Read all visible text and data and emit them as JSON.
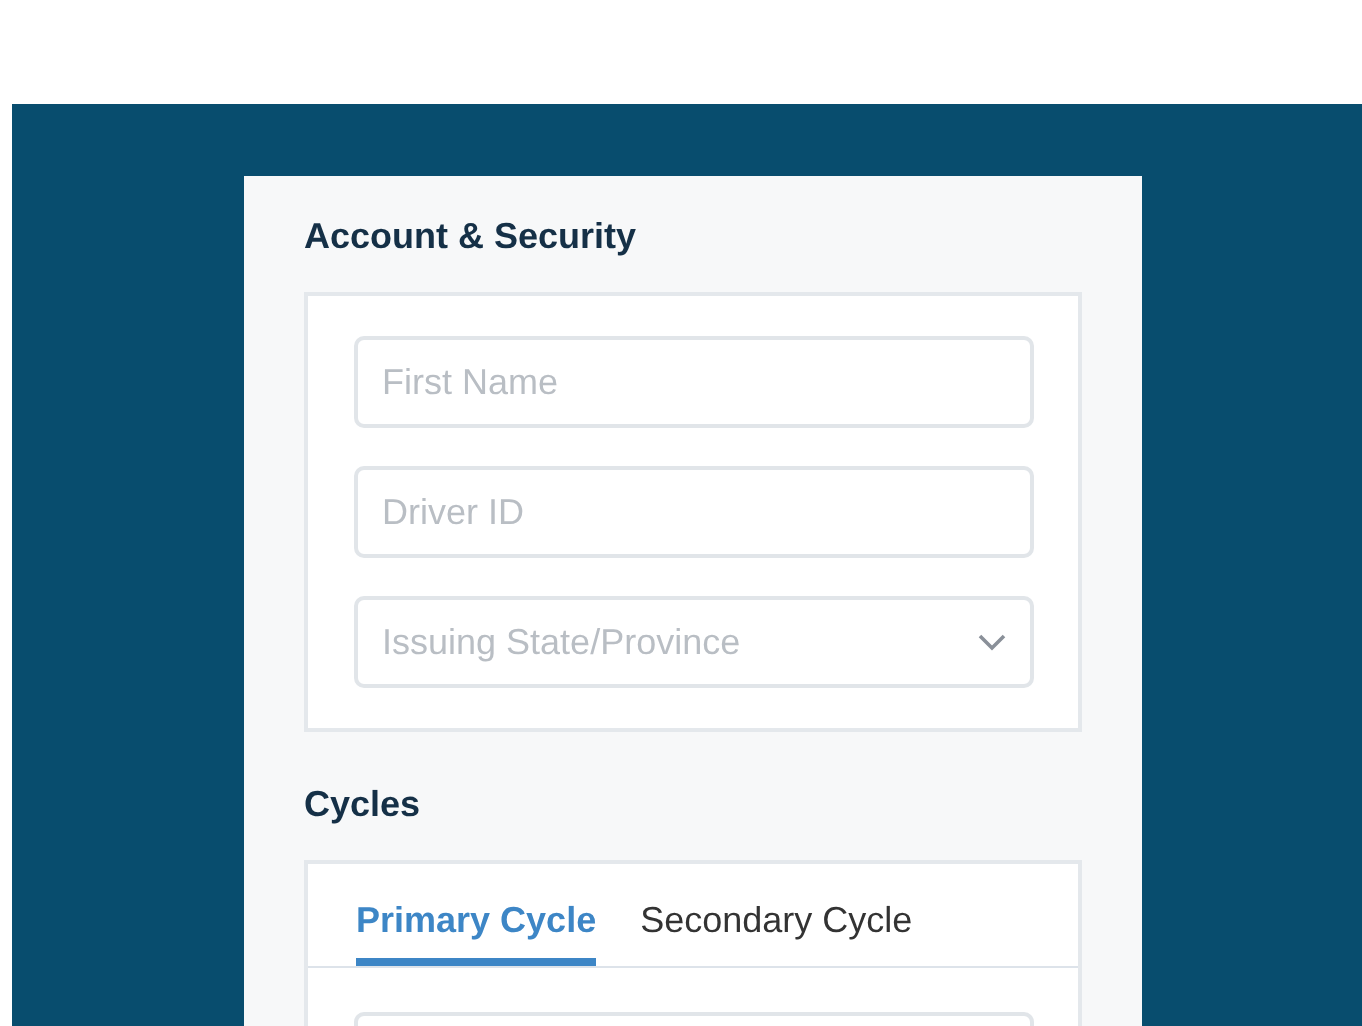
{
  "sections": [
    {
      "title": "Account & Security",
      "fields": [
        {
          "kind": "text",
          "placeholder": "First Name"
        },
        {
          "kind": "text",
          "placeholder": "Driver ID"
        },
        {
          "kind": "select",
          "placeholder": "Issuing State/Province"
        }
      ]
    },
    {
      "title": "Cycles",
      "tabs": [
        {
          "label": "Primary Cycle",
          "selected": true
        },
        {
          "label": "Secondary Cycle",
          "selected": false
        }
      ]
    }
  ]
}
